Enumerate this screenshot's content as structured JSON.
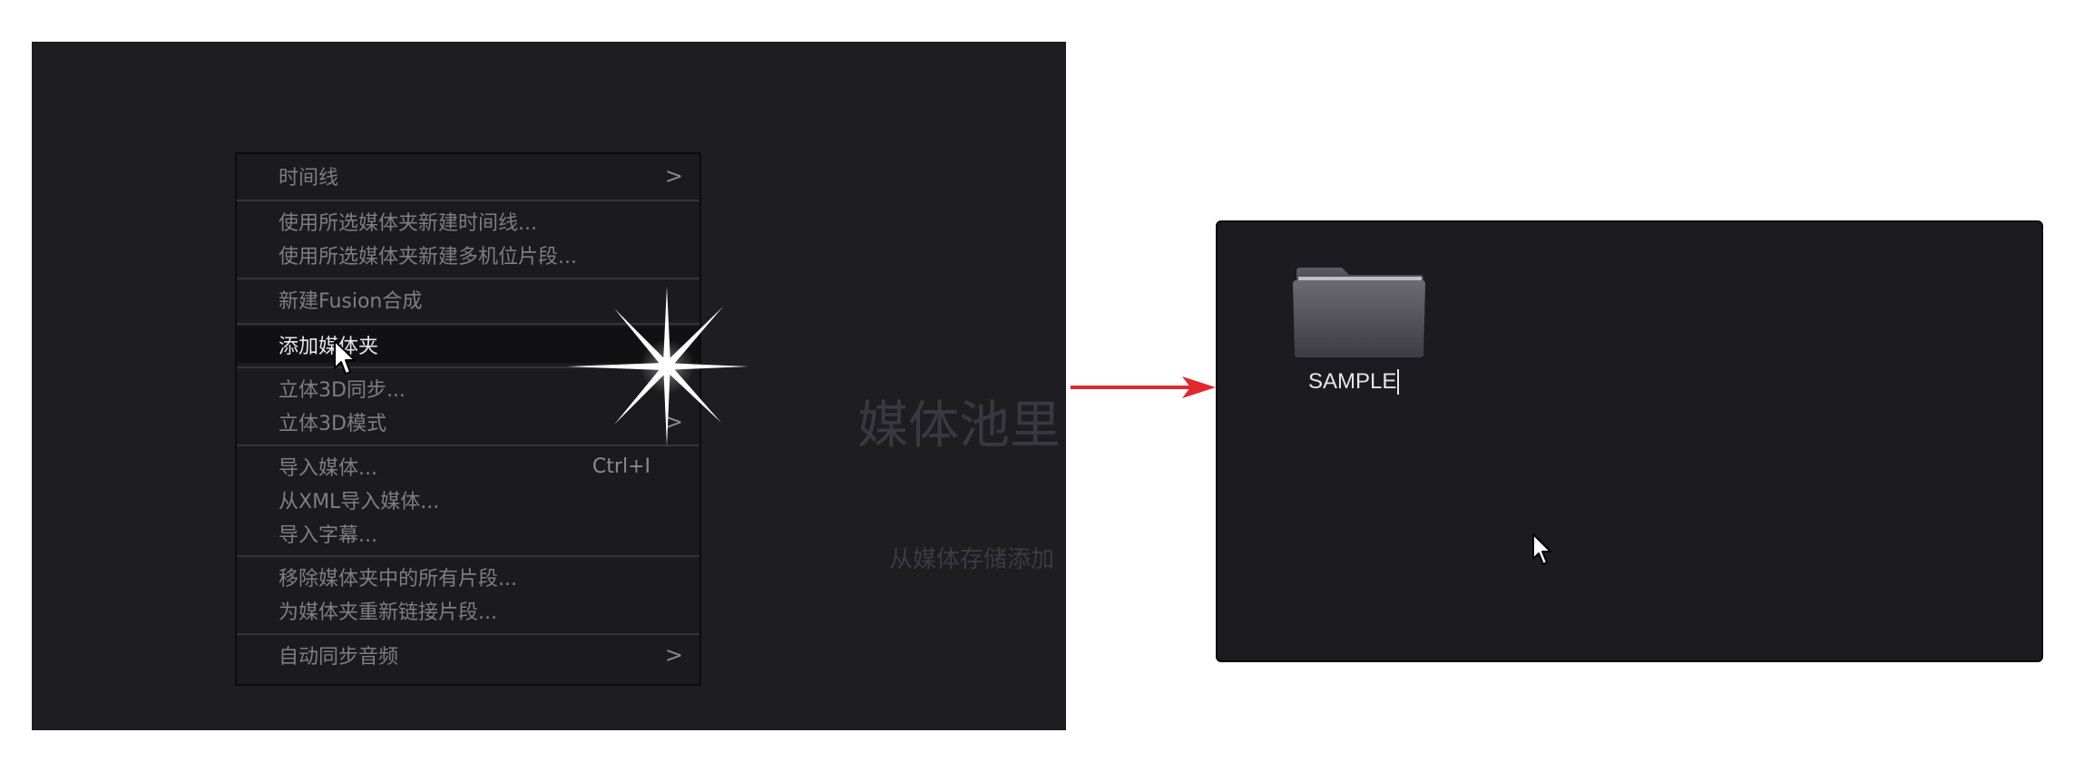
{
  "left_panel": {
    "background_heading": "媒体池里",
    "background_subtext": "从媒体存储添加",
    "context_menu": {
      "items": [
        {
          "label": "时间线",
          "submenu": true,
          "chevron": ">"
        },
        {
          "label": "使用所选媒体夹新建时间线..."
        },
        {
          "label": "使用所选媒体夹新建多机位片段..."
        },
        {
          "label": "新建Fusion合成"
        },
        {
          "label": "添加媒体夹",
          "highlighted": true
        },
        {
          "label": "立体3D同步..."
        },
        {
          "label": "立体3D模式",
          "submenu": true,
          "chevron": ">"
        },
        {
          "label": "导入媒体...",
          "shortcut": "Ctrl+I"
        },
        {
          "label": "从XML导入媒体..."
        },
        {
          "label": "导入字幕..."
        },
        {
          "label": "移除媒体夹中的所有片段..."
        },
        {
          "label": "为媒体夹重新链接片段..."
        },
        {
          "label": "自动同步音频",
          "submenu": true,
          "chevron": ">"
        }
      ]
    },
    "click_indicator_icon": "sparkle-icon",
    "pointer_icon": "mouse-pointer-icon"
  },
  "arrow": {
    "icon": "right-arrow-icon",
    "color": "#e0282e"
  },
  "right_panel": {
    "new_folder": {
      "name": "SAMPLE",
      "icon": "folder-icon",
      "editing": true
    },
    "pointer_icon": "mouse-pointer-icon"
  },
  "colors": {
    "panel_bg": "#1e1e22",
    "menu_text": "#7d7d84",
    "menu_highlight_text": "#e8e8ea",
    "arrow": "#e0282e"
  }
}
